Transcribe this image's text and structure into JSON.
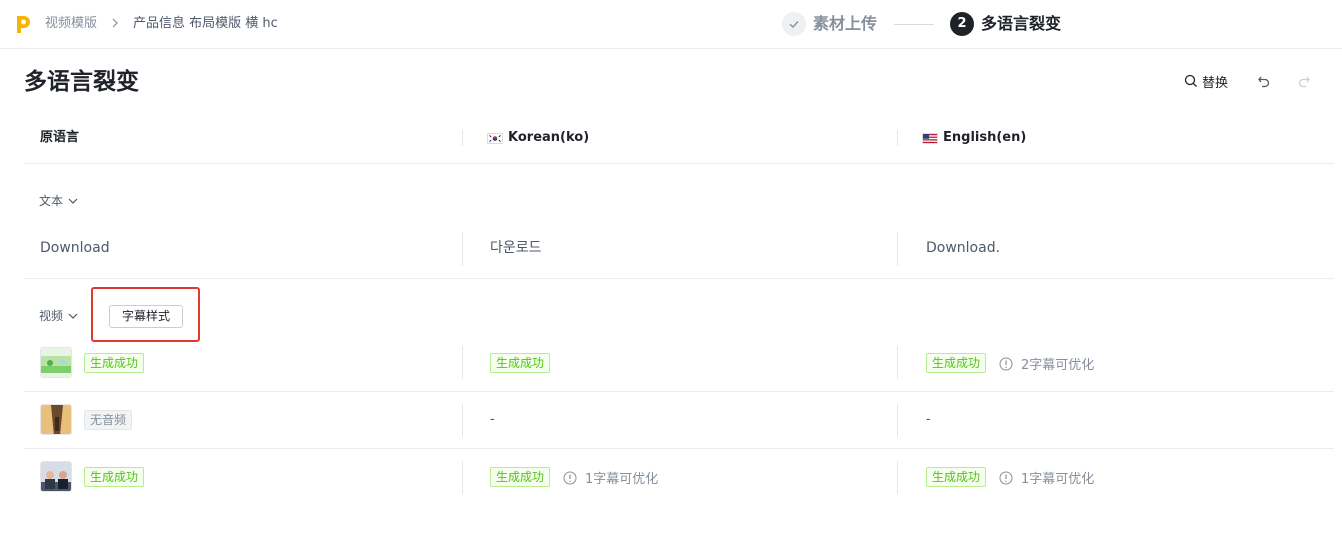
{
  "topbar": {
    "breadcrumb_root": "视频模版",
    "breadcrumb_current": "产品信息  布局模版  横  hc",
    "steps": [
      {
        "number": "",
        "label": "素材上传",
        "state": "done"
      },
      {
        "number": "2",
        "label": "多语言裂变",
        "state": "active"
      }
    ]
  },
  "page": {
    "title": "多语言裂变",
    "replace_label": "替换",
    "icons": [
      "search-icon",
      "undo-icon",
      "redo-icon"
    ]
  },
  "columns": [
    {
      "label": "原语言",
      "flag": ""
    },
    {
      "label": "Korean(ko)",
      "flag": "kr"
    },
    {
      "label": "English(en)",
      "flag": "us"
    }
  ],
  "text_section": {
    "toggle_label": "文本",
    "row": [
      "Download",
      "다운로드",
      "Download."
    ]
  },
  "video_section": {
    "toggle_label": "视频",
    "subtitle_style_button": "字幕样式",
    "rows": [
      {
        "source_status": "生成成功",
        "ko": {
          "status": "生成成功",
          "optimize": ""
        },
        "en": {
          "status": "生成成功",
          "optimize": "2字幕可优化"
        }
      },
      {
        "source_status": "无音频",
        "ko": {
          "status": "",
          "optimize": "",
          "placeholder": "-"
        },
        "en": {
          "status": "",
          "optimize": "",
          "placeholder": "-"
        }
      },
      {
        "source_status": "生成成功",
        "ko": {
          "status": "生成成功",
          "optimize": "1字幕可优化"
        },
        "en": {
          "status": "生成成功",
          "optimize": "1字幕可优化"
        }
      }
    ]
  },
  "colors": {
    "success_text": "#52c41a",
    "success_bg": "#f6ffed",
    "highlight": "#e03a30",
    "logo": "#f7b500"
  }
}
